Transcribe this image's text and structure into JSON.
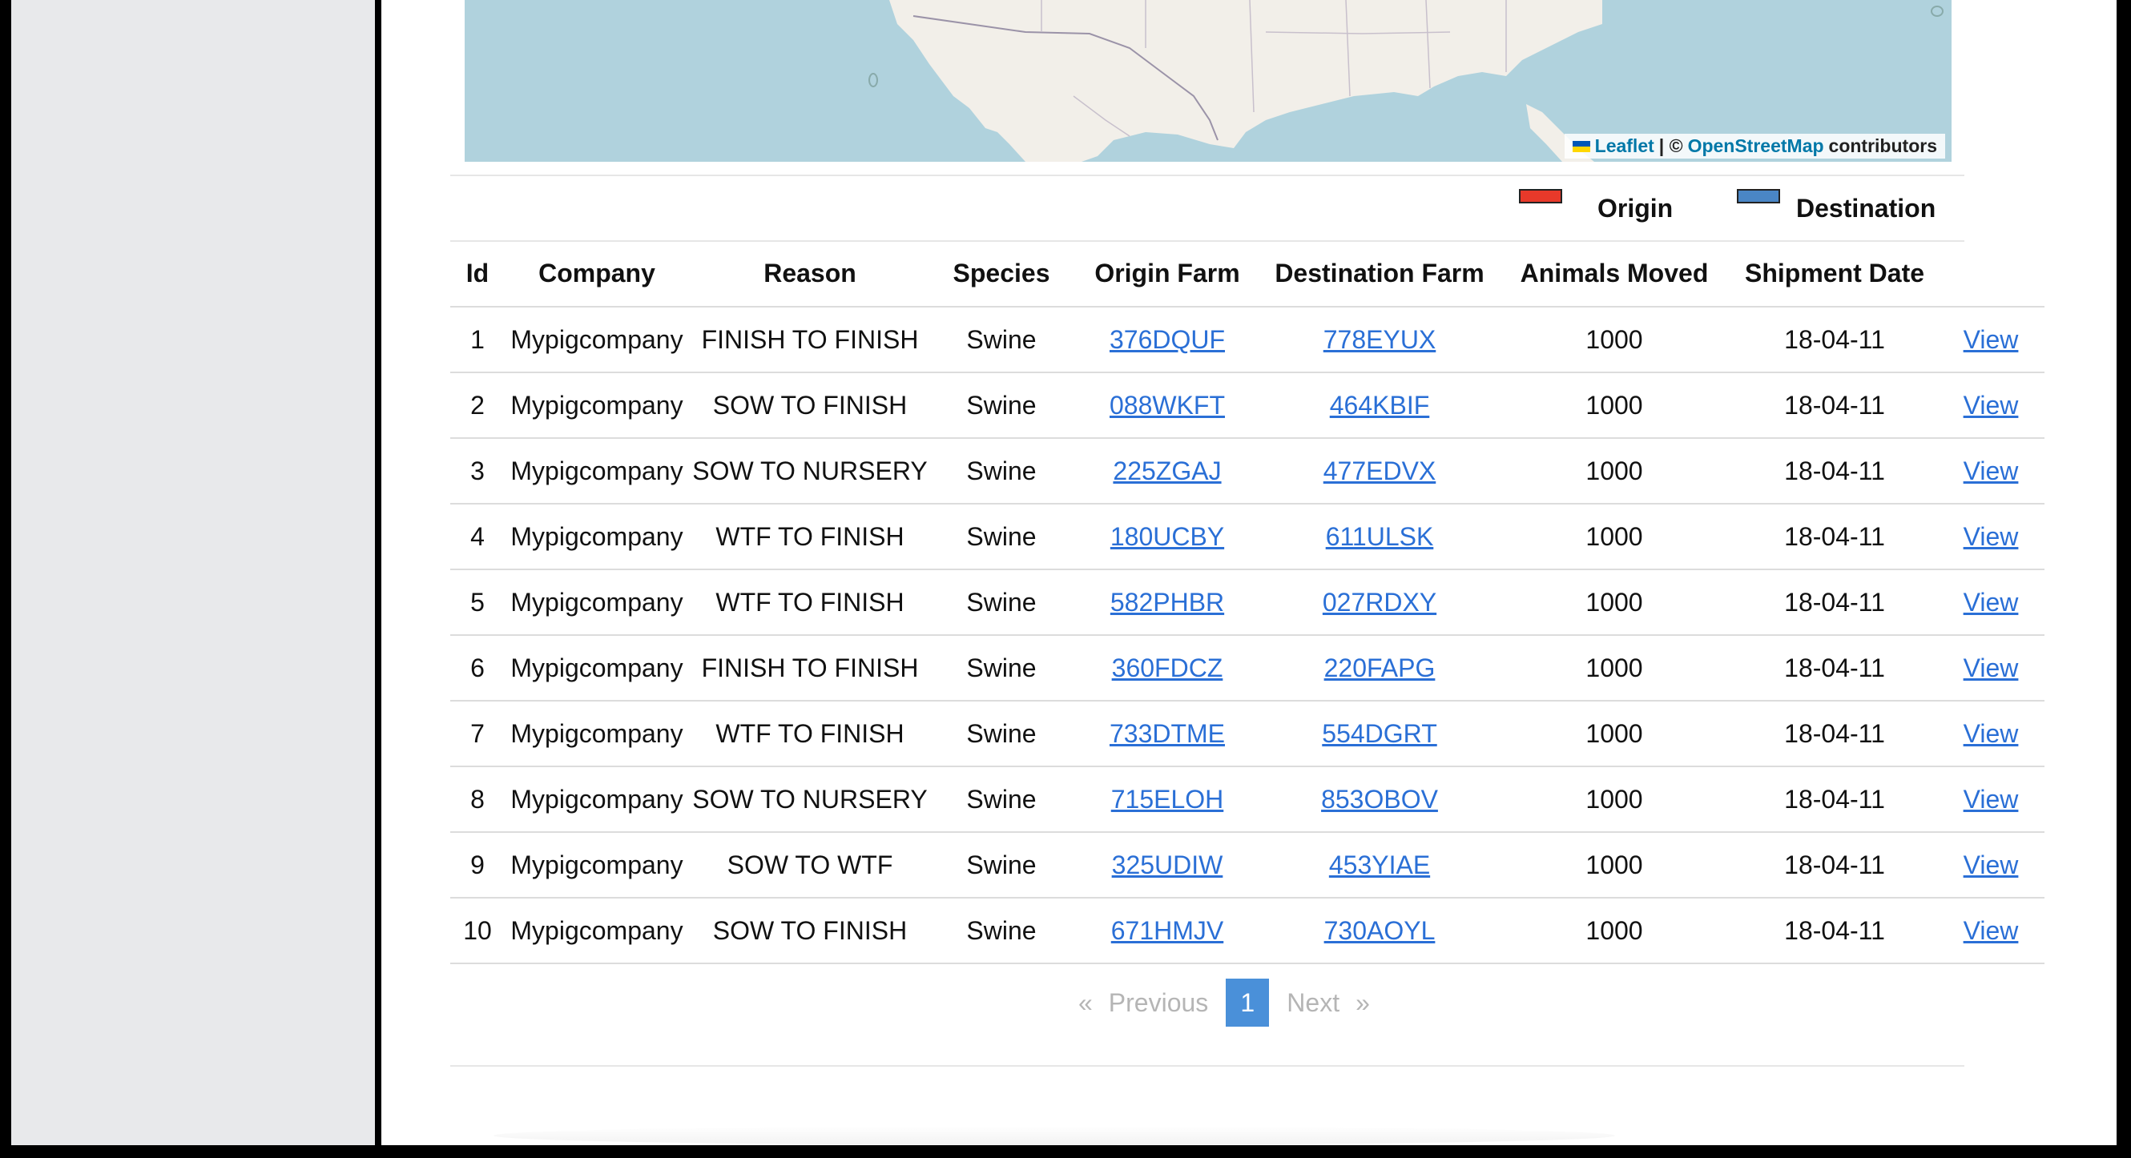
{
  "map": {
    "attribution_leaflet": "Leaflet",
    "attribution_sep": "| ©",
    "attribution_osm": "OpenStreetMap",
    "attribution_contrib": "contributors",
    "water_color": "#b0d2dd",
    "land_color": "#f2efe9"
  },
  "legend": {
    "origin_label": "Origin",
    "origin_color": "#e8392a",
    "destination_label": "Destination",
    "destination_color": "#4a86c5"
  },
  "table": {
    "headers": [
      "Id",
      "Company",
      "Reason",
      "Species",
      "Origin Farm",
      "Destination Farm",
      "Animals Moved",
      "Shipment Date",
      ""
    ],
    "rows": [
      {
        "id": "1",
        "company": "Mypigcompany",
        "reason": "FINISH TO FINISH",
        "species": "Swine",
        "origin": "376DQUF",
        "destination": "778EYUX",
        "animals": "1000",
        "date": "18-04-11",
        "action": "View"
      },
      {
        "id": "2",
        "company": "Mypigcompany",
        "reason": "SOW TO FINISH",
        "species": "Swine",
        "origin": "088WKFT",
        "destination": "464KBIF",
        "animals": "1000",
        "date": "18-04-11",
        "action": "View"
      },
      {
        "id": "3",
        "company": "Mypigcompany",
        "reason": "SOW TO NURSERY",
        "species": "Swine",
        "origin": "225ZGAJ",
        "destination": "477EDVX",
        "animals": "1000",
        "date": "18-04-11",
        "action": "View"
      },
      {
        "id": "4",
        "company": "Mypigcompany",
        "reason": "WTF TO FINISH",
        "species": "Swine",
        "origin": "180UCBY",
        "destination": "611ULSK",
        "animals": "1000",
        "date": "18-04-11",
        "action": "View"
      },
      {
        "id": "5",
        "company": "Mypigcompany",
        "reason": "WTF TO FINISH",
        "species": "Swine",
        "origin": "582PHBR",
        "destination": "027RDXY",
        "animals": "1000",
        "date": "18-04-11",
        "action": "View"
      },
      {
        "id": "6",
        "company": "Mypigcompany",
        "reason": "FINISH TO FINISH",
        "species": "Swine",
        "origin": "360FDCZ",
        "destination": "220FAPG",
        "animals": "1000",
        "date": "18-04-11",
        "action": "View"
      },
      {
        "id": "7",
        "company": "Mypigcompany",
        "reason": "WTF TO FINISH",
        "species": "Swine",
        "origin": "733DTME",
        "destination": "554DGRT",
        "animals": "1000",
        "date": "18-04-11",
        "action": "View"
      },
      {
        "id": "8",
        "company": "Mypigcompany",
        "reason": "SOW TO NURSERY",
        "species": "Swine",
        "origin": "715ELOH",
        "destination": "853OBOV",
        "animals": "1000",
        "date": "18-04-11",
        "action": "View"
      },
      {
        "id": "9",
        "company": "Mypigcompany",
        "reason": "SOW TO WTF",
        "species": "Swine",
        "origin": "325UDIW",
        "destination": "453YIAE",
        "animals": "1000",
        "date": "18-04-11",
        "action": "View"
      },
      {
        "id": "10",
        "company": "Mypigcompany",
        "reason": "SOW TO FINISH",
        "species": "Swine",
        "origin": "671HMJV",
        "destination": "730AOYL",
        "animals": "1000",
        "date": "18-04-11",
        "action": "View"
      }
    ]
  },
  "pagination": {
    "first": "«",
    "previous": "Previous",
    "current": "1",
    "next": "Next",
    "last": "»"
  }
}
